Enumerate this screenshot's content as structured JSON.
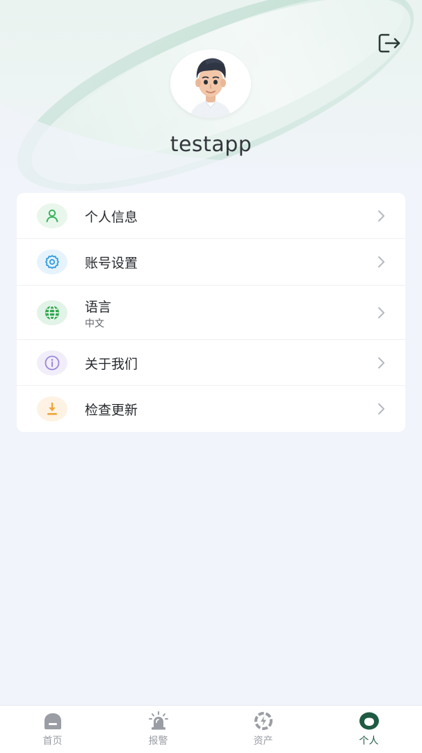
{
  "header": {
    "username": "testapp",
    "logout_icon": "logout-icon",
    "avatar": "user-avatar-illustration"
  },
  "menu": {
    "items": [
      {
        "key": "profile",
        "label": "个人信息",
        "sub": "",
        "icon": "person-icon",
        "icon_color": "#3bb35f",
        "icon_bg": "#e9f6ec"
      },
      {
        "key": "account",
        "label": "账号设置",
        "sub": "",
        "icon": "gear-icon",
        "icon_color": "#2f9be0",
        "icon_bg": "#e6f3fc"
      },
      {
        "key": "language",
        "label": "语言",
        "sub": "中文",
        "icon": "globe-icon",
        "icon_color": "#2fa84f",
        "icon_bg": "#e2f3e7"
      },
      {
        "key": "about",
        "label": "关于我们",
        "sub": "",
        "icon": "info-icon",
        "icon_color": "#9a86d8",
        "icon_bg": "#f1eefa"
      },
      {
        "key": "update",
        "label": "检查更新",
        "sub": "",
        "icon": "download-icon",
        "icon_color": "#f0a53a",
        "icon_bg": "#fdf2e3"
      }
    ]
  },
  "tabbar": {
    "tabs": [
      {
        "label": "首页",
        "icon": "home-icon",
        "active": false
      },
      {
        "label": "报警",
        "icon": "alarm-icon",
        "active": false
      },
      {
        "label": "资产",
        "icon": "asset-icon",
        "active": false
      },
      {
        "label": "个人",
        "icon": "profile-icon",
        "active": true
      }
    ]
  },
  "colors": {
    "accent": "#1f5b43",
    "inactive": "#9a9da3",
    "background": "#f1f4fb"
  }
}
